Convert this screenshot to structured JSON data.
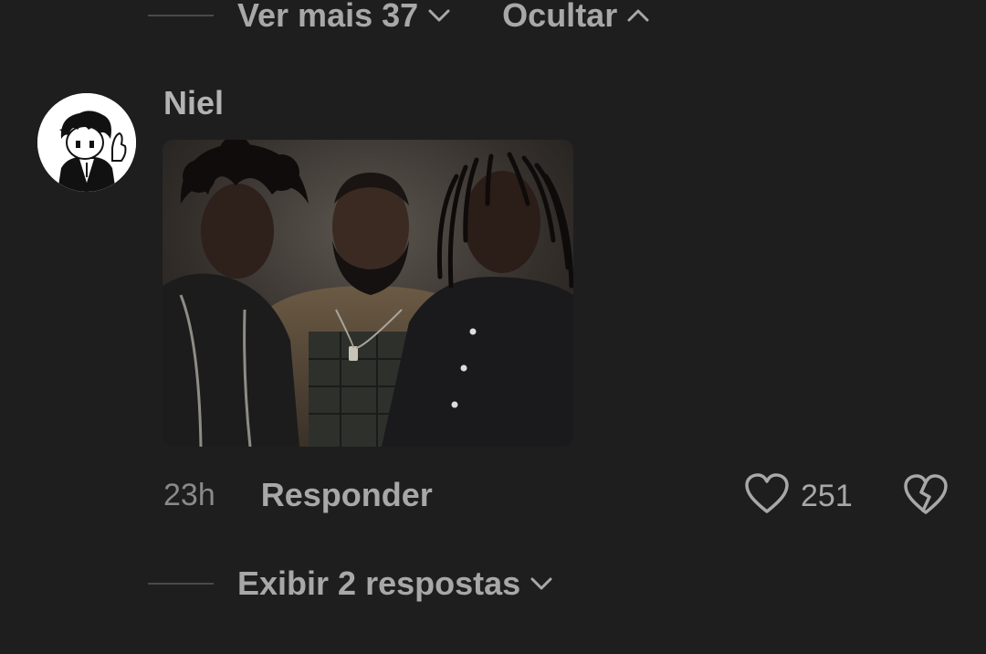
{
  "thread_top": {
    "see_more_label": "Ver mais 37",
    "see_more_icon": "chevron-down-icon",
    "hide_label": "Ocultar",
    "hide_icon": "chevron-up-icon"
  },
  "comment": {
    "username": "Niel",
    "avatar_icon": "cartoon-avatar",
    "image_alt": "three men in dark clothing posing",
    "timestamp": "23h",
    "reply_label": "Responder",
    "like_icon": "heart-icon",
    "like_count": "251",
    "dislike_icon": "broken-heart-icon"
  },
  "thread_bottom": {
    "show_replies_label": "Exibir 2 respostas",
    "show_replies_icon": "chevron-down-icon"
  },
  "colors": {
    "background": "#1e1e1f",
    "text_primary": "#a8a8a8",
    "text_secondary": "#8a8a8a",
    "thread_line": "#4a4a4a"
  }
}
